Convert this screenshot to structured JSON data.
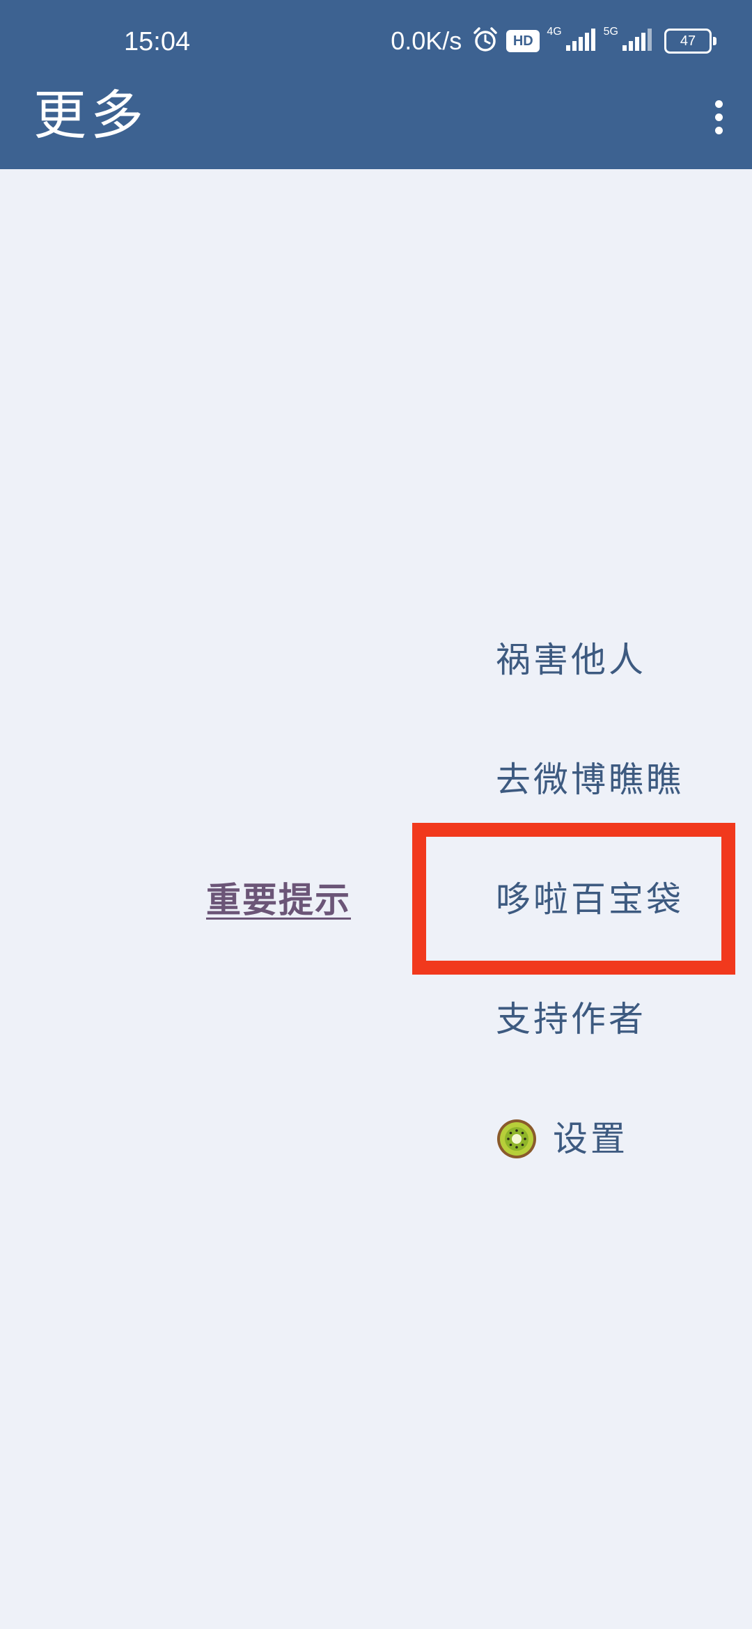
{
  "status_bar": {
    "time": "15:04",
    "net_speed": "0.0K/s",
    "hd_label": "HD",
    "sim1_network": "4G",
    "sim2_network": "5G",
    "battery_level": "47"
  },
  "appbar": {
    "title": "更多",
    "overflow_icon": "more-vertical-icon"
  },
  "notice": {
    "label": "重要提示"
  },
  "menu": {
    "items": [
      {
        "label": "祸害他人"
      },
      {
        "label": "去微博瞧瞧"
      },
      {
        "label": "哆啦百宝袋"
      },
      {
        "label": "支持作者"
      },
      {
        "label": "设置",
        "icon": "kiwi-icon"
      }
    ]
  },
  "colors": {
    "appbar": "#3d6291",
    "background": "#eef1f8",
    "menu_text": "#3d5a80",
    "notice_text": "#6b5577",
    "highlight": "#f1391d"
  }
}
